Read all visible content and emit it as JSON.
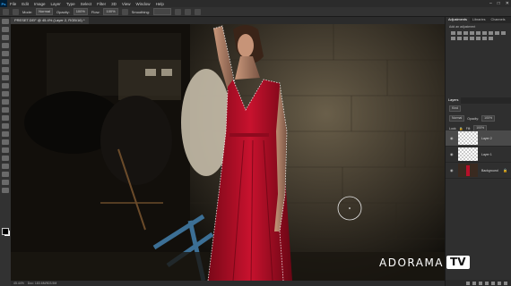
{
  "menubar": {
    "logo": "Ps",
    "items": [
      "File",
      "Edit",
      "Image",
      "Layer",
      "Type",
      "Select",
      "Filter",
      "3D",
      "View",
      "Window",
      "Help"
    ]
  },
  "options": {
    "mode_label": "Mode:",
    "mode_value": "Normal",
    "opacity_label": "Opacity:",
    "opacity_value": "100%",
    "flow_label": "Flow:",
    "flow_value": "100%",
    "smoothing_label": "Smoothing:"
  },
  "document": {
    "tab_title": "PRESET.DEF @ 45.4% (Layer 2, RGB/16) *"
  },
  "status": {
    "zoom": "45.44%",
    "info": "Doc: 183.6M/503.5M"
  },
  "panels": {
    "adj_tabs": [
      "Adjustments",
      "Libraries",
      "Channels"
    ],
    "adj_hint": "Add an adjustment",
    "layers_tabs": [
      "Layers"
    ],
    "kind_label": "Kind",
    "blend_mode": "Normal",
    "opacity_label": "Opacity:",
    "opacity_value": "100%",
    "lock_label": "Lock:",
    "fill_label": "Fill:",
    "fill_value": "100%",
    "layers": [
      "Layer 2",
      "Layer 1",
      "Background"
    ]
  },
  "watermark": {
    "brand": "ADORAMA",
    "tv": "TV"
  },
  "icons": [
    "close-icon",
    "minimize-icon",
    "maximize-icon",
    "eye-icon",
    "lock-icon",
    "brush-icon"
  ],
  "colors": {
    "dress": "#b8102a",
    "ui_dark": "#323232",
    "selection": "#ffffff"
  }
}
